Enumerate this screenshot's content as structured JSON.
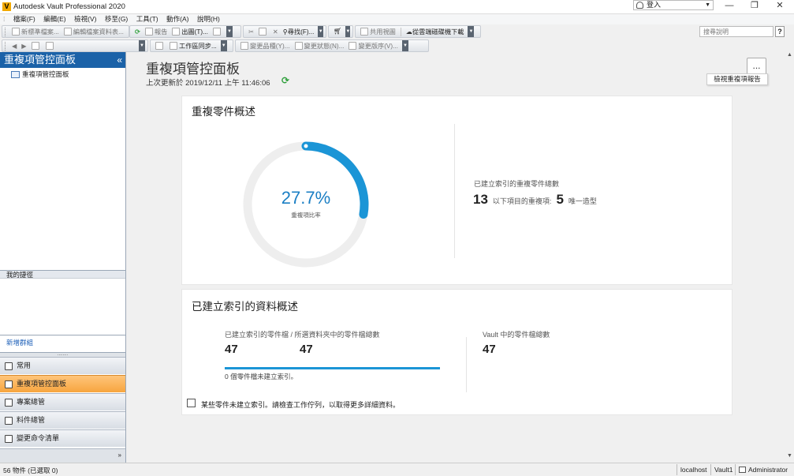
{
  "window": {
    "title": "Autodesk Vault Professional 2020",
    "logo_letter": "V",
    "login_label": "登入",
    "minimize": "—",
    "maximize": "❐",
    "close": "✕"
  },
  "menubar": [
    "檔案(F)",
    "編輯(E)",
    "檢視(V)",
    "移至(G)",
    "工具(T)",
    "動作(A)",
    "說明(H)"
  ],
  "toolbar1": {
    "new_standard_folder": "新標準檔案...",
    "edit_file_data": "編輯檔案資料表...",
    "report": "報告",
    "print": "出圖(T)...",
    "find": "尋找(F)...",
    "shared_view": "共用視圖",
    "download_from_cloud": "從雲端磁碟機下載"
  },
  "toolbar2": {
    "workspace_sync": "工作區同步...",
    "change_item": "變更品種(Y)...",
    "change_state": "變更狀態(N)...",
    "change_revision": "變更版序(V)..."
  },
  "help_search": {
    "placeholder": "搜尋說明",
    "help_button": "?"
  },
  "left_panel": {
    "header": "重複項管控面板",
    "collapse": "«",
    "tree_item": "重複項管控面板",
    "favorites_header": "我的捷徑",
    "new_group": "新增群組",
    "splitter": "........",
    "nav": [
      {
        "label": "常用",
        "active": false
      },
      {
        "label": "重複項管控面板",
        "active": true
      },
      {
        "label": "專案總管",
        "active": false
      },
      {
        "label": "料件總管",
        "active": false
      },
      {
        "label": "變更命令清單",
        "active": false
      }
    ],
    "expand": "»"
  },
  "main": {
    "title": "重複項管控面板",
    "last_updated": "上次更新於 2019/12/11 上午 11:46:06",
    "refresh_icon": "⟳",
    "more_button": "...",
    "tooltip": "檢視重複項報告"
  },
  "duplicate_overview": {
    "title": "重複零件概述",
    "percent": 27.7,
    "percent_text": "27.7%",
    "percent_label": "重複項比率",
    "total_label": "已建立索引的重複零件總數",
    "total_count": "13",
    "duplicates_label": "以下項目的重複項:",
    "duplicates_count": "5",
    "unique_label": "唯一造型"
  },
  "indexed_overview": {
    "title": "已建立索引的資料概述",
    "label": "已建立索引的零件檔 / 所選資料夾中的零件檔總數",
    "indexed": "47",
    "total": "47",
    "not_indexed": "0 個零件檔未建立索引。",
    "vault_label": "Vault 中的零件檔總數",
    "vault_total": "47",
    "warning": "某些零件未建立索引。請檢查工作佇列，以取得更多詳細資料。"
  },
  "colors": {
    "accent_blue": "#1b95d6",
    "header_blue": "#1b62a8",
    "active_orange": "#f7a53f",
    "refresh_green": "#2e9f3a"
  },
  "statusbar": {
    "count": "56 物件 (已選取 0)",
    "server": "localhost",
    "vault": "Vault1",
    "user": "Administrator"
  }
}
